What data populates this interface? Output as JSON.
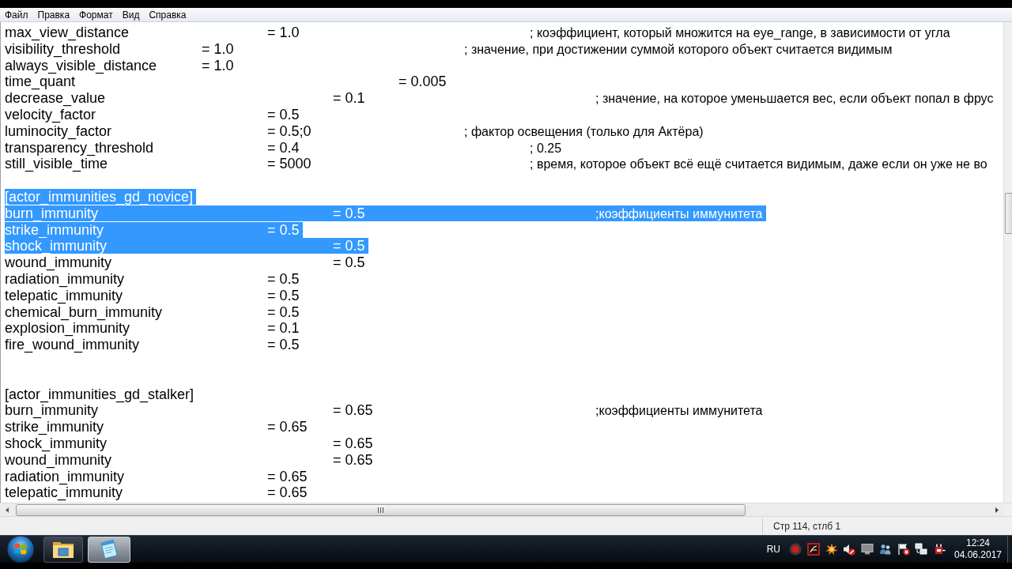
{
  "menu": [
    "Файл",
    "Правка",
    "Формат",
    "Вид",
    "Справка"
  ],
  "editor": {
    "lines": [
      {
        "text": "max_view_distance\t\t\t= 1.0\t\t\t\t; коэффициент, который множится на eye_range, в зависимости от угла",
        "selected": false
      },
      {
        "text": "visibility_threshold\t\t= 1.0\t\t\t\t; значение, при достижении суммой которого объект считается видимым",
        "selected": false
      },
      {
        "text": "always_visible_distance\t= 1.0",
        "selected": false
      },
      {
        "text": "time_quant\t\t\t\t\t= 0.005",
        "selected": false
      },
      {
        "text": "decrease_value\t\t\t\t= 0.1\t\t\t\t; значение, на которое уменьшается вес, если объект попал в фрус",
        "selected": false
      },
      {
        "text": "velocity_factor\t\t\t= 0.5",
        "selected": false
      },
      {
        "text": "luminocity_factor\t\t\t= 0.5;0\t\t\t; фактор освещения (только для Актёра)",
        "selected": false
      },
      {
        "text": "transparency_threshold\t\t= 0.4\t\t\t\t; 0.25",
        "selected": false
      },
      {
        "text": "still_visible_time\t\t\t= 5000\t\t\t\t; время, которое объект всё ещё считается видимым, даже если он уже не во",
        "selected": false
      },
      {
        "selected": false
      },
      {
        "section": "[actor_immunities_gd_novice]",
        "selected": true
      },
      {
        "text": "burn_immunity\t\t\t\t= 0.5\t\t\t\t;коэффициенты иммунитета",
        "selected": true
      },
      {
        "text": "strike_immunity\t\t\t= 0.5",
        "selected": true
      },
      {
        "text": "shock_immunity\t\t\t\t= 0.5",
        "selected": true
      },
      {
        "text": "wound_immunity\t\t\t\t= 0.5",
        "selected": false
      },
      {
        "text": "radiation_immunity\t\t\t= 0.5",
        "selected": false
      },
      {
        "text": "telepatic_immunity\t\t\t= 0.5",
        "selected": false
      },
      {
        "text": "chemical_burn_immunity\t\t= 0.5",
        "selected": false
      },
      {
        "text": "explosion_immunity\t\t\t= 0.1",
        "selected": false
      },
      {
        "text": "fire_wound_immunity\t\t= 0.5",
        "selected": false
      },
      {
        "selected": false
      },
      {
        "selected": false
      },
      {
        "section": "[actor_immunities_gd_stalker]",
        "selected": false
      },
      {
        "text": "burn_immunity\t\t\t\t= 0.65\t\t\t\t;коэффициенты иммунитета",
        "selected": false
      },
      {
        "text": "strike_immunity\t\t\t= 0.65",
        "selected": false
      },
      {
        "text": "shock_immunity\t\t\t\t= 0.65",
        "selected": false
      },
      {
        "text": "wound_immunity\t\t\t\t= 0.65",
        "selected": false
      },
      {
        "text": "radiation_immunity\t\t\t= 0.65",
        "selected": false
      },
      {
        "text": "telepatic_immunity\t\t\t= 0.65",
        "selected": false
      }
    ]
  },
  "status_bar": {
    "position": "Стр 114, стлб 1"
  },
  "taskbar": {
    "buttons": [
      {
        "selected": false
      },
      {
        "selected": true
      }
    ],
    "tray": {
      "language": "RU",
      "time": "12:24",
      "date": "04.06.2017"
    }
  }
}
